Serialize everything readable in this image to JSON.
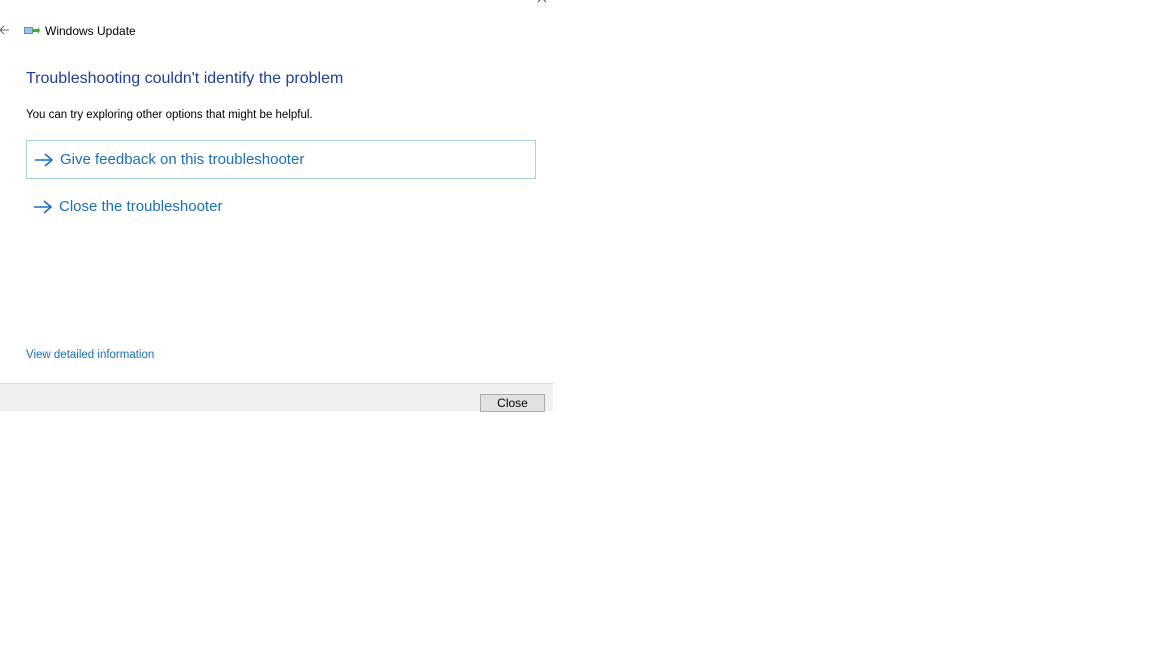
{
  "window": {
    "title": "Windows Update",
    "app_icon": "windows-update-icon",
    "back_icon": "back-arrow-icon",
    "close_icon": "close-icon"
  },
  "content": {
    "heading": "Troubleshooting couldn't identify the problem",
    "subtext": "You can try exploring other options that might be helpful.",
    "options": [
      {
        "label": "Give feedback on this troubleshooter",
        "icon": "arrow-right-icon",
        "focused": true
      },
      {
        "label": "Close the troubleshooter",
        "icon": "arrow-right-icon",
        "focused": false
      }
    ],
    "detail_link": "View detailed information"
  },
  "footer": {
    "close_label": "Close"
  },
  "colors": {
    "heading": "#1d3f99",
    "link": "#1a6fbd",
    "focus_border": "#a9cfe9",
    "footer_bg": "#f0f0f0"
  }
}
